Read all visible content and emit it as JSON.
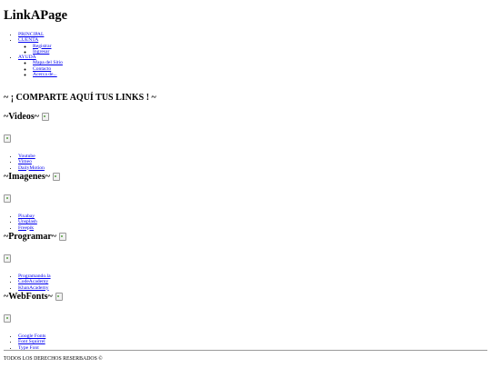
{
  "site_title": "LinkAPage",
  "nav": {
    "principal": "PRINCIPAL",
    "cuenta": "CUENTA",
    "cuenta_items": [
      "Registrar",
      "Ingresar"
    ],
    "ayuda": "AYUDA",
    "ayuda_items": [
      "Mapa del Sitio",
      "Contacto",
      "Acerca de..."
    ]
  },
  "tagline": "~ ¡ COMPARTE AQUÍ TUS LINKS ! ~",
  "sections": [
    {
      "title": "~Videos~",
      "links": [
        "Youtube",
        "Vimeo",
        "DailyMotion"
      ]
    },
    {
      "title": "~Imagenes~",
      "links": [
        "Pixabay",
        "Unsplash",
        "Freepik"
      ]
    },
    {
      "title": "~Programar~",
      "links": [
        "Programando.la",
        "CodeAcademy",
        "KhanAcademy"
      ]
    },
    {
      "title": "~WebFonts~",
      "links": [
        "Google Fonts",
        "Font Squirrel",
        "Type Font"
      ]
    }
  ],
  "footer": "TODOS LOS DERECHOS RESERBADOS ©",
  "icons": {
    "broken_image": "broken-image-icon"
  }
}
